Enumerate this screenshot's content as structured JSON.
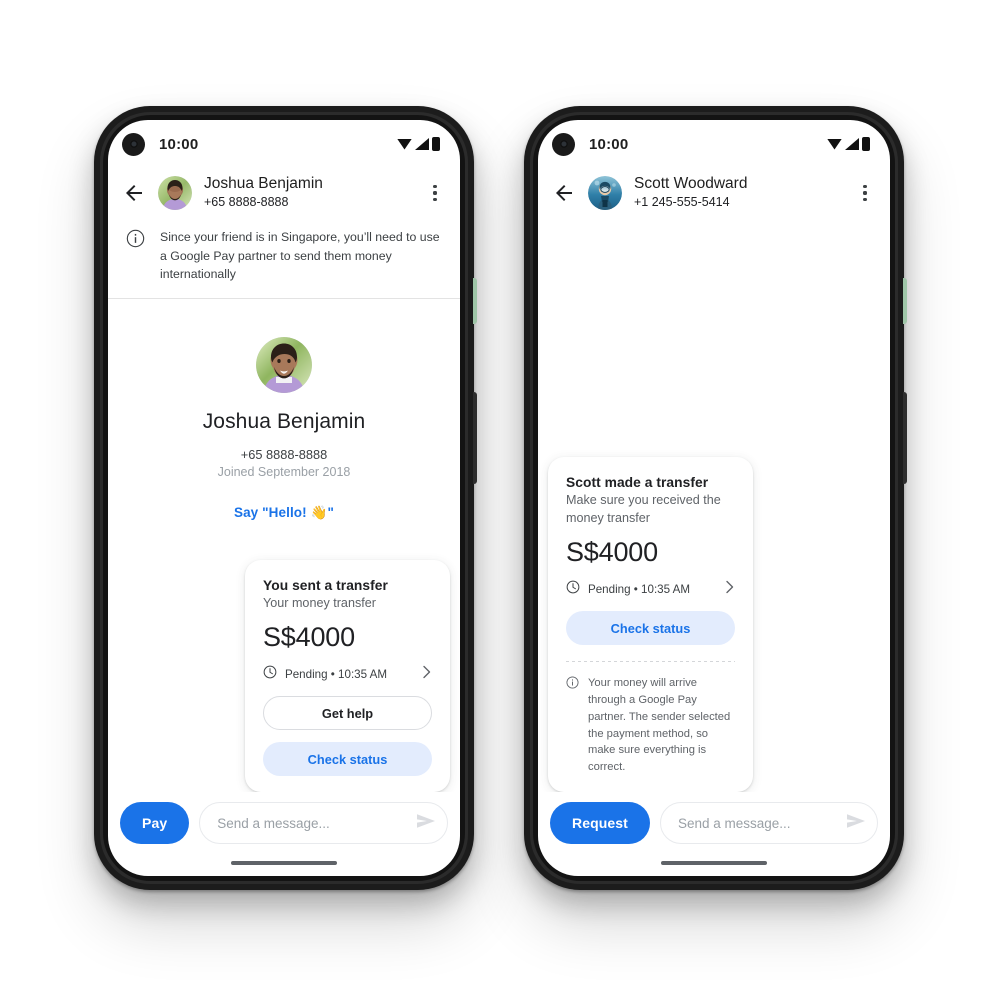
{
  "background_color": "#ffffff",
  "accent_color": "#1a73e8",
  "tonal_button_color": "#e3ecfd",
  "phones": [
    {
      "id": "sender-phone",
      "status_bar": {
        "time": "10:00",
        "icons": [
          "wifi-icon",
          "signal-icon",
          "battery-icon"
        ]
      },
      "app_bar": {
        "back_icon": "back-arrow-icon",
        "avatar": "joshua-avatar",
        "contact_name": "Joshua Benjamin",
        "contact_phone": "+65 8888-8888",
        "overflow_icon": "more-vert-icon"
      },
      "banner": {
        "icon": "info-icon",
        "text": "Since your friend is in Singapore, you’ll need to use a Google Pay partner to send them money internationally"
      },
      "profile": {
        "avatar": "joshua-avatar-large",
        "name": "Joshua Benjamin",
        "phone": "+65 8888-8888",
        "joined": "Joined September 2018",
        "greeting_link": "Say \"Hello! 👋\""
      },
      "card": {
        "title": "You sent a transfer",
        "subtitle": "Your money transfer",
        "amount": "S$4000",
        "status_icon": "clock-icon",
        "status_text": "Pending • 10:35 AM",
        "chevron_icon": "chevron-right-icon",
        "buttons": [
          {
            "label": "Get help",
            "style": "outline"
          },
          {
            "label": "Check status",
            "style": "tonal"
          }
        ]
      },
      "composer": {
        "action_label": "Pay",
        "input_value": "",
        "input_placeholder": "Send a message...",
        "send_icon": "send-icon"
      }
    },
    {
      "id": "receiver-phone",
      "status_bar": {
        "time": "10:00",
        "icons": [
          "wifi-icon",
          "signal-icon",
          "battery-icon"
        ]
      },
      "app_bar": {
        "back_icon": "back-arrow-icon",
        "avatar": "scott-avatar",
        "contact_name": "Scott Woodward",
        "contact_phone": "+1 245-555-5414",
        "overflow_icon": "more-vert-icon"
      },
      "card": {
        "title": "Scott made a transfer",
        "subtitle": "Make sure you received the money transfer",
        "amount": "S$4000",
        "status_icon": "clock-icon",
        "status_text": "Pending • 10:35 AM",
        "chevron_icon": "chevron-right-icon",
        "buttons": [
          {
            "label": "Check status",
            "style": "tonal"
          }
        ],
        "note_icon": "info-icon",
        "note_text": "Your money will arrive through a Google Pay partner. The sender selected the payment method, so make sure everything is correct."
      },
      "composer": {
        "action_label": "Request",
        "input_value": "",
        "input_placeholder": "Send a message...",
        "send_icon": "send-icon"
      }
    }
  ]
}
